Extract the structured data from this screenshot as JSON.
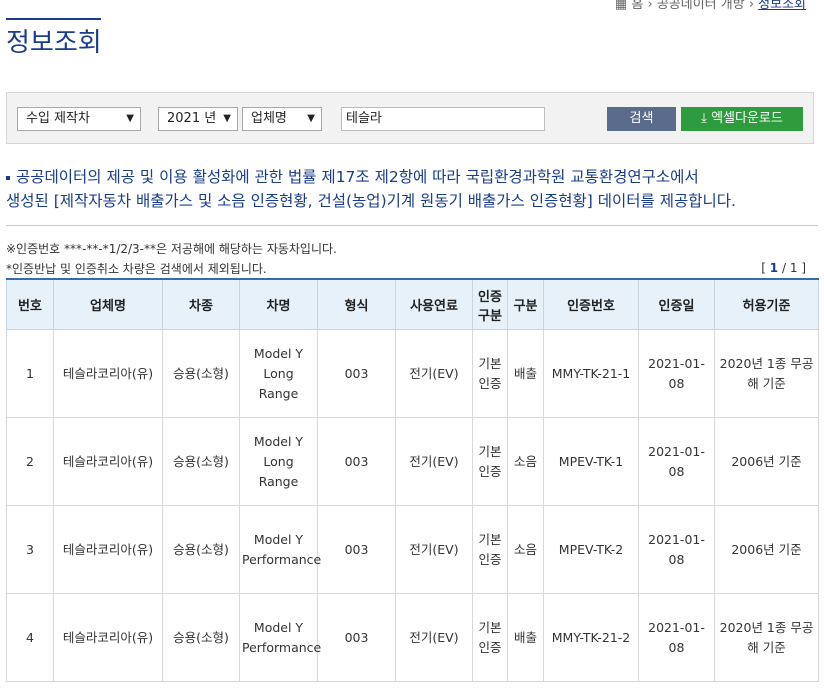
{
  "breadcrumb": {
    "home": "홈",
    "section": "공공데이터 개방",
    "current": "정보조회"
  },
  "page_title": "정보조회",
  "filters": {
    "type_select": "수입 제작차",
    "year_select": "2021 년",
    "field_select": "업체명",
    "search_value": "테슬라",
    "search_button": "검색",
    "excel_button": "엑셀다운로드"
  },
  "notice": {
    "line1": "공공데이터의 제공 및 이용 활성화에 관한 법률 제17조 제2항에 따라 국립환경과학원 교통환경연구소에서",
    "line2": "생성된 [제작자동차 배출가스 및 소음 인증현황, 건설(농업)기계 원동기 배출가스 인증현황] 데이터를 제공합니다."
  },
  "notes": {
    "note1": "※인증번호 ***-**-*1/2/3-**은 저공해에 해당하는 자동차입니다.",
    "note2": "*인증반납 및 인증취소 차량은 검색에서 제외됩니다."
  },
  "pager": {
    "open": "[",
    "current": "1",
    "sep": "/",
    "total": "1",
    "close": "]"
  },
  "table": {
    "headers": [
      "번호",
      "업체명",
      "차종",
      "차명",
      "형식",
      "사용연료",
      "인증구분",
      "구분",
      "인증번호",
      "인증일",
      "허용기준"
    ],
    "rows": [
      {
        "no": "1",
        "company": "테슬라코리아(유)",
        "type": "승용(소형)",
        "name": "Model Y Long Range",
        "form": "003",
        "fuel": "전기(EV)",
        "cert_type": "기본인증",
        "div": "배출",
        "cert_no": "MMY-TK-21-1",
        "date": "2021-01-08",
        "standard": "2020년 1종 무공해 기준"
      },
      {
        "no": "2",
        "company": "테슬라코리아(유)",
        "type": "승용(소형)",
        "name": "Model Y Long Range",
        "form": "003",
        "fuel": "전기(EV)",
        "cert_type": "기본인증",
        "div": "소음",
        "cert_no": "MPEV-TK-1",
        "date": "2021-01-08",
        "standard": "2006년 기준"
      },
      {
        "no": "3",
        "company": "테슬라코리아(유)",
        "type": "승용(소형)",
        "name": "Model Y Performance",
        "form": "003",
        "fuel": "전기(EV)",
        "cert_type": "기본인증",
        "div": "소음",
        "cert_no": "MPEV-TK-2",
        "date": "2021-01-08",
        "standard": "2006년 기준"
      },
      {
        "no": "4",
        "company": "테슬라코리아(유)",
        "type": "승용(소형)",
        "name": "Model Y Performance",
        "form": "003",
        "fuel": "전기(EV)",
        "cert_type": "기본인증",
        "div": "배출",
        "cert_no": "MMY-TK-21-2",
        "date": "2021-01-08",
        "standard": "2020년 1종 무공해 기준"
      }
    ]
  }
}
